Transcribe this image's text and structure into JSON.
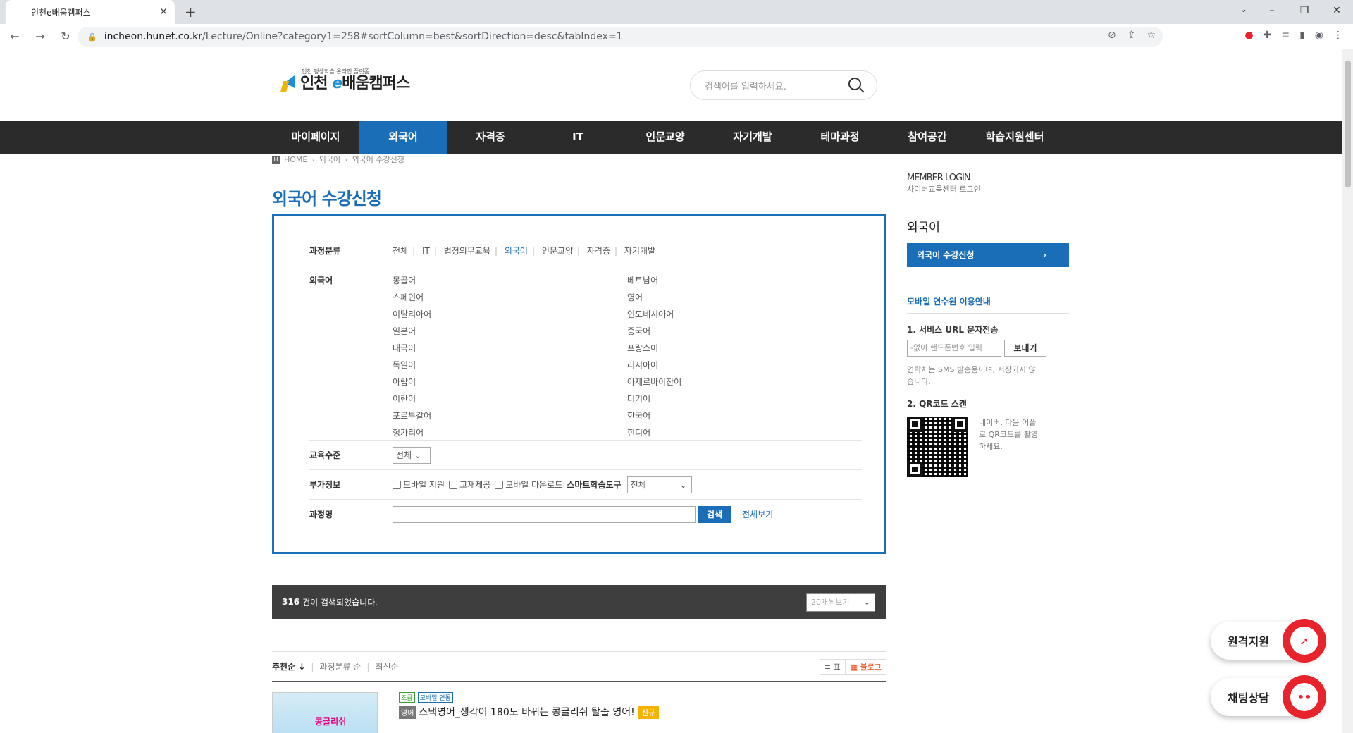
{
  "browser": {
    "tab_title": "인천e배움캠퍼스",
    "url_host": "incheon.hunet.co.kr",
    "url_path": "/Lecture/Online?category1=258#sortColumn=best&sortDirection=desc&tabIndex=1"
  },
  "header": {
    "logo_sub": "인천 평생학습 온라인 플랫폼",
    "logo_name_pre": "인천",
    "logo_name_e": "e",
    "logo_name_post": "배움캠퍼스",
    "search_placeholder": "검색어를 입력하세요."
  },
  "gnb": [
    "마이페이지",
    "외국어",
    "자격증",
    "IT",
    "인문교양",
    "자기개발",
    "테마과정",
    "참여공간",
    "학습지원센터"
  ],
  "breadcrumb": [
    "HOME",
    "외국어",
    "외국어 수강신청"
  ],
  "page_title": "외국어 수강신청",
  "filter": {
    "category_label": "과정분류",
    "categories": [
      "전체",
      "IT",
      "법정의무교육",
      "외국어",
      "인문교양",
      "자격증",
      "자기개발"
    ],
    "language_label": "외국어",
    "languages": [
      "몽골어",
      "베트남어",
      "스페인어",
      "영어",
      "이탈리아어",
      "인도네시아어",
      "일본어",
      "중국어",
      "태국어",
      "프랑스어",
      "독일어",
      "러시아어",
      "아랍어",
      "아제르바이잔어",
      "이란어",
      "터키어",
      "포르투갈어",
      "한국어",
      "헝가리어",
      "힌디어"
    ],
    "level_label": "교육수준",
    "level_value": "전체",
    "extra_label": "부가정보",
    "checks": [
      "모바일 지원",
      "교재제공",
      "모바일 다운로드"
    ],
    "smart_label": "스마트학습도구",
    "smart_value": "전체",
    "name_label": "과정명",
    "search_btn": "검색",
    "view_all": "전체보기"
  },
  "result": {
    "count": "316",
    "text": "건이 검색되었습니다.",
    "per_page": "20개씩보기"
  },
  "sort": {
    "items": [
      "추천순 ↓",
      "과정분류 순",
      "최신순"
    ],
    "view_list": "≡ 표",
    "view_blog": "▦ 블로그"
  },
  "course": {
    "thumb_text": "콩글리쉬",
    "tag1": "초급",
    "tag2": "모바일 연동",
    "level": "영어",
    "title": "스낵영어_생각이 180도 바뀌는 콩글리쉬 탈출 영어!",
    "badge": "신규"
  },
  "side": {
    "login_title": "MEMBER LOGIN",
    "login_sub": "사이버교육센터 로그인",
    "section": "외국어",
    "menu": "외국어 수강신청",
    "mobile_title": "모바일 연수원 이용안내",
    "step1": "1. 서비스 URL 문자전송",
    "sms_placeholder": "-없이 핸드폰번호 입력",
    "send": "보내기",
    "note": "연락처는 SMS 발송용이며, 저장되지 않습니다.",
    "step2": "2. QR코드 스캔",
    "qr_note": "네이버, 다음 어플로 QR코드를 촬영하세요."
  },
  "floating": {
    "remote": "원격지원",
    "chat": "채팅상담"
  }
}
